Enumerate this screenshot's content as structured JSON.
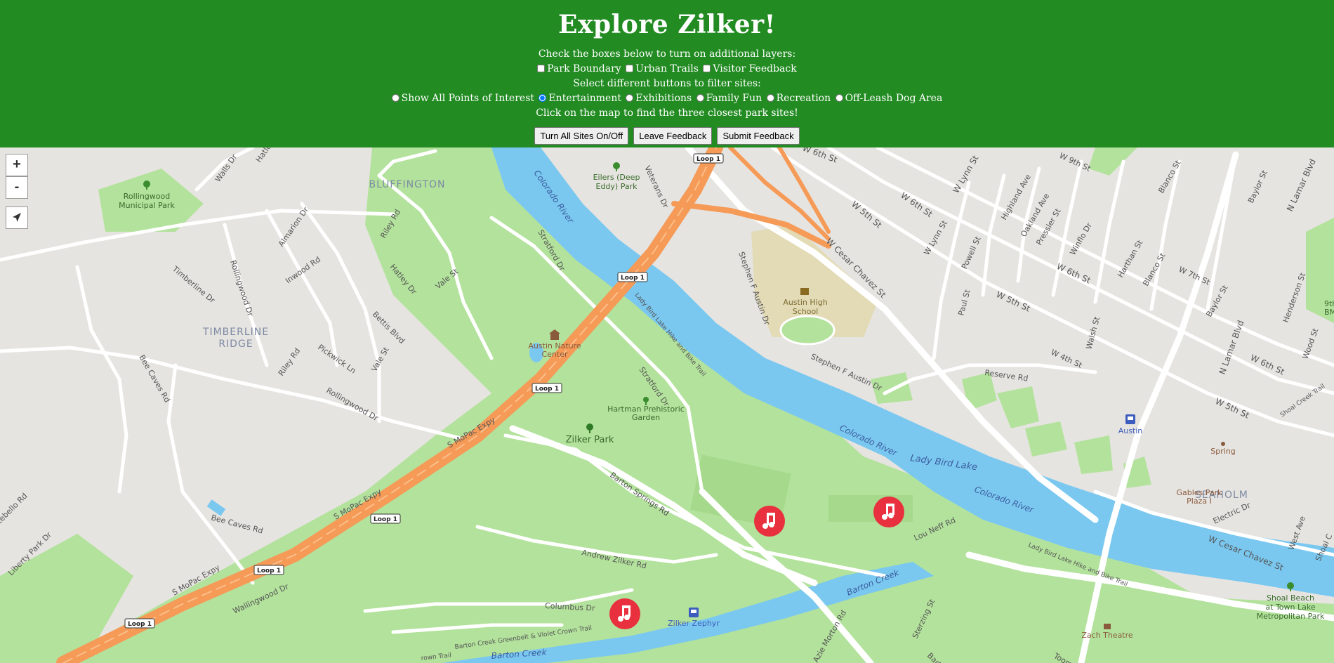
{
  "header": {
    "title": "Explore Zilker!",
    "layers_prompt": "Check the boxes below to turn on additional layers:",
    "layers": [
      {
        "label": "Park Boundary",
        "checked": false
      },
      {
        "label": "Urban Trails",
        "checked": false
      },
      {
        "label": "Visitor Feedback",
        "checked": false
      }
    ],
    "filter_prompt": "Select different buttons to filter sites:",
    "filters": [
      {
        "label": "Show All Points of Interest",
        "selected": false
      },
      {
        "label": "Entertainment",
        "selected": true
      },
      {
        "label": "Exhibitions",
        "selected": false
      },
      {
        "label": "Family Fun",
        "selected": false
      },
      {
        "label": "Recreation",
        "selected": false
      },
      {
        "label": "Off-Leash Dog Area",
        "selected": false
      }
    ],
    "click_prompt": "Click on the map to find the three closest park sites!",
    "buttons": {
      "toggle_sites": "Turn All Sites On/Off",
      "leave_feedback": "Leave Feedback",
      "submit_feedback": "Submit Feedback"
    }
  },
  "map": {
    "controls": {
      "zoom_in": "+",
      "zoom_out": "-"
    },
    "colors": {
      "header": "#228b22",
      "park": "#b3e29c",
      "water": "#7ac8f0",
      "highway": "#f59a57",
      "marker": "#e8303f"
    },
    "marker_icon": "music-note-icon",
    "neighborhoods": {
      "bluffington": "BLUFFINGTON",
      "timberline_1": "TIMBERLINE",
      "timberline_2": "RIDGE",
      "seaholm": "SEAHOLM"
    },
    "places": {
      "rollingwood_1": "Rollingwood",
      "rollingwood_2": "Municipal Park",
      "eilers_1": "Eilers (Deep",
      "eilers_2": "Eddy) Park",
      "nature_1": "Austin Nature",
      "nature_2": "Center",
      "hartman_1": "Hartman Prehistoric",
      "hartman_2": "Garden",
      "zilker_park": "Zilker Park",
      "austin_hs_1": "Austin High",
      "austin_hs_2": "School",
      "austin_station": "Austin",
      "spring": "Spring",
      "gables_1": "Gables Park",
      "gables_2": "Plaza I",
      "zephyr": "Zilker Zephyr",
      "zach": "Zach Theatre",
      "shoal_1": "Shoal Beach",
      "shoal_2": "at Town Lake",
      "shoal_3": "Metropolitan Park",
      "bmx_1": "9th S",
      "bmx_2": "BMX"
    },
    "water": {
      "colorado_1": "Colorado River",
      "colorado_2": "Colorado River",
      "colorado_3": "Colorado River",
      "lady_bird": "Lady Bird Lake",
      "barton_creek_1": "Barton Creek",
      "barton_creek_2": "Barton Creek"
    },
    "shields": [
      "Loop 1",
      "Loop 1",
      "Loop 1",
      "Loop 1",
      "Loop 1",
      "Loop 1"
    ],
    "streets": {
      "walls": "Walls Dr",
      "hatley_top": "Hatley Dr",
      "almarion": "Almarion Dr",
      "riley_top": "Riley Rd",
      "inwood": "Inwood Rd",
      "hatley": "Hatley Dr",
      "vale_top": "Vale St",
      "vale": "Vale St",
      "timberline": "Timberline Dr",
      "rollingwood": "Rollingwood Dr",
      "rollingwood_low": "Rollingwood Dr",
      "bettis": "Bettis Blvd",
      "pickwick": "Pickwick Ln",
      "riley": "Riley Rd",
      "bee_caves_v": "Bee Caves Rd",
      "bee_caves": "Bee Caves Rd",
      "s_mopac_1": "S MoPac Expy",
      "s_mopac_2": "S MoPac Expy",
      "s_mopac_3": "S MoPac Expy",
      "liberty": "Liberty Park Dr",
      "stebello": "tebello Rd",
      "wallingwood": "Wallingwood Dr",
      "stratford_top": "Stratford Dr",
      "stratford": "Stratford Dr",
      "veterans": "Veterans Dr",
      "ladybird_trail_1": "Lady Bird Lake Hike and Bike Trail",
      "ladybird_trail_2": "Lady Bird Lake Hike and Bike Trail",
      "barton_springs": "Barton Springs Rd",
      "andrew_zilker": "Andrew Zilker Rd",
      "columbus": "Columbus Dr",
      "greenbelt": "Barton Creek Greenbelt & Violet Crown Trail",
      "crown_trail": "rown Trail",
      "lou_neff": "Lou Neff Rd",
      "azie_morton": "Azie Morton Rd",
      "sterzing": "Sterzing St",
      "toomey": "Toomey Rd",
      "barton_rd": "Barto",
      "stephen_v": "Stephen F Austin Dr",
      "stephen": "Stephen F Austin Dr",
      "cesar_chavez": "W Cesar Chavez St",
      "cesar_chavez_low": "W Cesar Chavez St",
      "w5th_1": "W 5th St",
      "w5th_2": "W 5th St",
      "w5th_3": "W 5th St",
      "w6th_1": "W 6th St",
      "w6th_2": "W 6th St",
      "w6th_3": "W 6th St",
      "w6th_top": "W 6th St",
      "w9th": "W 9th St",
      "w7th": "W 7th St",
      "w4th": "W 4th St",
      "wlynn_1": "W Lynn St",
      "wlynn_2": "W Lynn St",
      "highland": "Highland Ave",
      "oakland": "Oakland Ave",
      "pressler": "Pressler St",
      "winflo": "Winflo Dr",
      "powell": "Powell St",
      "paul": "Paul St",
      "harthan": "Harthan St",
      "blanco_1": "Blanco St",
      "blanco_2": "Blanco St",
      "baylor_1": "Baylor St",
      "baylor_2": "Baylor St",
      "n_lamar_1": "N Lamar Blvd",
      "n_lamar_2": "N Lamar Blvd",
      "henderson": "Henderson St",
      "wood": "Wood St",
      "walsh": "Walsh St",
      "reserve": "Reserve Rd",
      "shoal_creek": "Shoal Creek Trail",
      "electric": "Electric Dr",
      "west_ave": "West Ave",
      "shoal_creek_edge": "Shoal C"
    }
  }
}
